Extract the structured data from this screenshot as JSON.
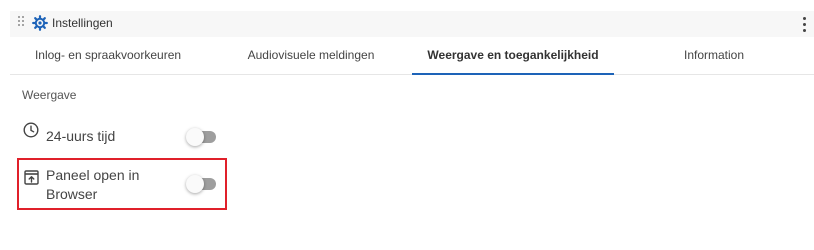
{
  "header": {
    "title": "Instellingen",
    "icon": "gear-icon",
    "accent_color": "#1d63b8"
  },
  "tabs": [
    {
      "label": "Inlog- en spraakvoorkeuren",
      "active": false
    },
    {
      "label": "Audiovisuele meldingen",
      "active": false
    },
    {
      "label": "Weergave en toegankelijkheid",
      "active": true
    },
    {
      "label": "Information",
      "active": false
    }
  ],
  "display": {
    "section_label": "Weergave",
    "settings": [
      {
        "label": "24-uurs tijd",
        "icon": "clock-icon",
        "enabled": false
      },
      {
        "label_line1": "Paneel open in",
        "label_line2": "Browser",
        "icon": "open-in-browser-icon",
        "enabled": false,
        "highlighted": true,
        "highlight_color": "#e0202a"
      }
    ]
  }
}
